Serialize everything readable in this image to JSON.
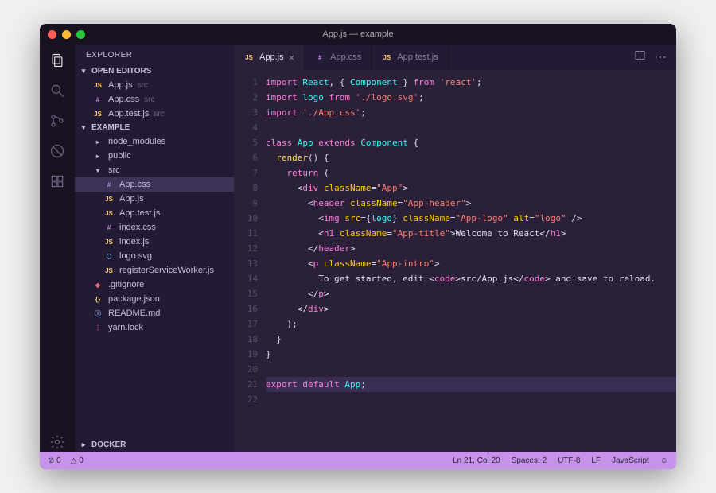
{
  "window": {
    "title": "App.js — example"
  },
  "sidebar": {
    "title": "EXPLORER",
    "openEditorsLabel": "OPEN EDITORS",
    "openEditors": [
      {
        "icon": "JS",
        "name": "App.js",
        "dir": "src"
      },
      {
        "icon": "#",
        "name": "App.css",
        "dir": "src"
      },
      {
        "icon": "JS",
        "name": "App.test.js",
        "dir": "src"
      }
    ],
    "projectLabel": "EXAMPLE",
    "tree": [
      {
        "depth": 1,
        "icon": "▸",
        "kind": "folder",
        "name": "node_modules"
      },
      {
        "depth": 1,
        "icon": "▸",
        "kind": "folder",
        "name": "public"
      },
      {
        "depth": 1,
        "icon": "▾",
        "kind": "folder",
        "name": "src"
      },
      {
        "depth": 2,
        "icon": "#",
        "kind": "css",
        "name": "App.css",
        "active": true
      },
      {
        "depth": 2,
        "icon": "JS",
        "kind": "js",
        "name": "App.js"
      },
      {
        "depth": 2,
        "icon": "JS",
        "kind": "js",
        "name": "App.test.js"
      },
      {
        "depth": 2,
        "icon": "#",
        "kind": "css",
        "name": "index.css"
      },
      {
        "depth": 2,
        "icon": "JS",
        "kind": "js",
        "name": "index.js"
      },
      {
        "depth": 2,
        "icon": "⬡",
        "kind": "svg",
        "name": "logo.svg"
      },
      {
        "depth": 2,
        "icon": "JS",
        "kind": "js",
        "name": "registerServiceWorker.js"
      },
      {
        "depth": 1,
        "icon": "◆",
        "kind": "git",
        "name": ".gitignore"
      },
      {
        "depth": 1,
        "icon": "{}",
        "kind": "json",
        "name": "package.json"
      },
      {
        "depth": 1,
        "icon": "ⓘ",
        "kind": "md",
        "name": "README.md"
      },
      {
        "depth": 1,
        "icon": "⋮",
        "kind": "lock",
        "name": "yarn.lock"
      }
    ],
    "dockerLabel": "DOCKER"
  },
  "tabs": [
    {
      "icon": "JS",
      "iconKind": "js",
      "label": "App.js",
      "active": true,
      "close": true
    },
    {
      "icon": "#",
      "iconKind": "css",
      "label": "App.css",
      "active": false
    },
    {
      "icon": "JS",
      "iconKind": "js",
      "label": "App.test.js",
      "active": false
    }
  ],
  "code": {
    "lines": [
      [
        [
          "kw",
          "import"
        ],
        [
          "",
          " "
        ],
        [
          "id",
          "React"
        ],
        [
          "",
          ", { "
        ],
        [
          "id",
          "Component"
        ],
        [
          "",
          " } "
        ],
        [
          "kw",
          "from"
        ],
        [
          "",
          " "
        ],
        [
          "str",
          "'react'"
        ],
        [
          "",
          ";"
        ]
      ],
      [
        [
          "kw",
          "import"
        ],
        [
          "",
          " "
        ],
        [
          "id",
          "logo"
        ],
        [
          "",
          " "
        ],
        [
          "kw",
          "from"
        ],
        [
          "",
          " "
        ],
        [
          "str",
          "'./logo.svg'"
        ],
        [
          "",
          ";"
        ]
      ],
      [
        [
          "kw",
          "import"
        ],
        [
          "",
          " "
        ],
        [
          "str",
          "'./App.css'"
        ],
        [
          "",
          ";"
        ]
      ],
      [],
      [
        [
          "kw",
          "class"
        ],
        [
          "",
          " "
        ],
        [
          "id",
          "App"
        ],
        [
          "",
          " "
        ],
        [
          "kw",
          "extends"
        ],
        [
          "",
          " "
        ],
        [
          "id",
          "Component"
        ],
        [
          "",
          " {"
        ]
      ],
      [
        [
          "",
          "  "
        ],
        [
          "fn",
          "render"
        ],
        [
          "",
          "() {"
        ]
      ],
      [
        [
          "",
          "    "
        ],
        [
          "kw",
          "return"
        ],
        [
          "",
          " ("
        ]
      ],
      [
        [
          "",
          "      <"
        ],
        [
          "tag",
          "div"
        ],
        [
          "",
          " "
        ],
        [
          "attr",
          "className"
        ],
        [
          "",
          "="
        ],
        [
          "str",
          "\"App\""
        ],
        [
          "",
          ">"
        ]
      ],
      [
        [
          "",
          "        <"
        ],
        [
          "tag",
          "header"
        ],
        [
          "",
          " "
        ],
        [
          "attr",
          "className"
        ],
        [
          "",
          "="
        ],
        [
          "str",
          "\"App-header\""
        ],
        [
          "",
          ">"
        ]
      ],
      [
        [
          "",
          "          <"
        ],
        [
          "tag",
          "img"
        ],
        [
          "",
          " "
        ],
        [
          "attr",
          "src"
        ],
        [
          "",
          "={"
        ],
        [
          "id",
          "logo"
        ],
        [
          "",
          "} "
        ],
        [
          "attr",
          "className"
        ],
        [
          "",
          "="
        ],
        [
          "str",
          "\"App-logo\""
        ],
        [
          "",
          " "
        ],
        [
          "attr",
          "alt"
        ],
        [
          "",
          "="
        ],
        [
          "str",
          "\"logo\""
        ],
        [
          "",
          " />"
        ]
      ],
      [
        [
          "",
          "          <"
        ],
        [
          "tag",
          "h1"
        ],
        [
          "",
          " "
        ],
        [
          "attr",
          "className"
        ],
        [
          "",
          "="
        ],
        [
          "str",
          "\"App-title\""
        ],
        [
          "",
          ">Welcome to React</"
        ],
        [
          "tag",
          "h1"
        ],
        [
          "",
          ">"
        ]
      ],
      [
        [
          "",
          "        </"
        ],
        [
          "tag",
          "header"
        ],
        [
          "",
          ">"
        ]
      ],
      [
        [
          "",
          "        <"
        ],
        [
          "tag",
          "p"
        ],
        [
          "",
          " "
        ],
        [
          "attr",
          "className"
        ],
        [
          "",
          "="
        ],
        [
          "str",
          "\"App-intro\""
        ],
        [
          "",
          ">"
        ]
      ],
      [
        [
          "",
          "          To get started, edit <"
        ],
        [
          "tag",
          "code"
        ],
        [
          "",
          ">src/App.js</"
        ],
        [
          "tag",
          "code"
        ],
        [
          "",
          "> and save to reload."
        ]
      ],
      [
        [
          "",
          "        </"
        ],
        [
          "tag",
          "p"
        ],
        [
          "",
          ">"
        ]
      ],
      [
        [
          "",
          "      </"
        ],
        [
          "tag",
          "div"
        ],
        [
          "",
          ">"
        ]
      ],
      [
        [
          "",
          "    );"
        ]
      ],
      [
        [
          "",
          "  }"
        ]
      ],
      [
        [
          "",
          "}"
        ]
      ],
      [],
      [
        [
          "kw",
          "export"
        ],
        [
          "",
          " "
        ],
        [
          "kw",
          "default"
        ],
        [
          "",
          " "
        ],
        [
          "id",
          "App"
        ],
        [
          "",
          ";"
        ]
      ],
      []
    ],
    "activeLine": 21
  },
  "statusbar": {
    "errors": "0",
    "warnings": "0",
    "position": "Ln 21, Col 20",
    "spaces": "Spaces: 2",
    "encoding": "UTF-8",
    "eol": "LF",
    "language": "JavaScript"
  }
}
